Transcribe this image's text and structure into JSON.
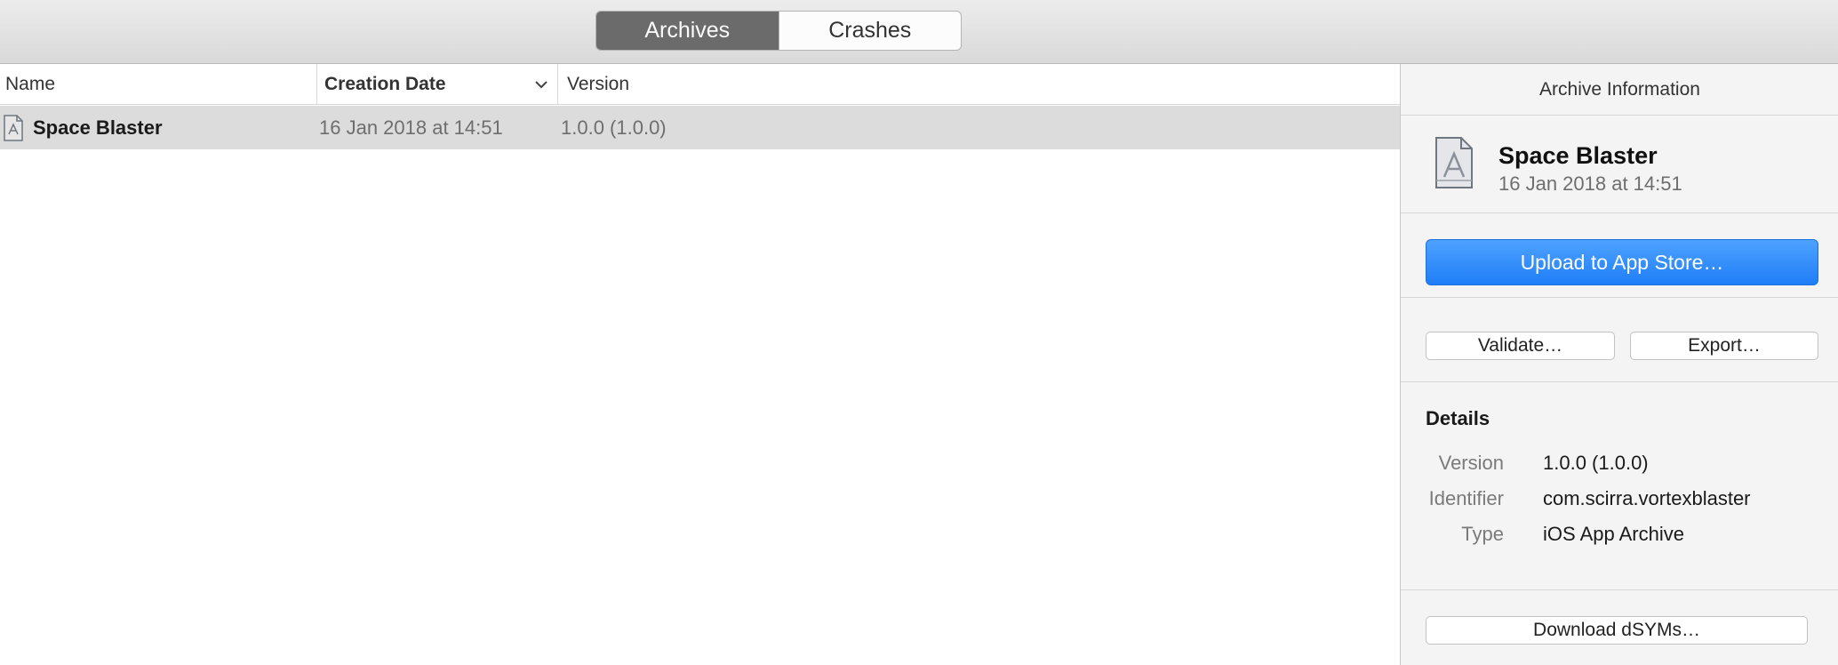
{
  "toolbar": {
    "tabs": [
      {
        "label": "Archives",
        "active": true
      },
      {
        "label": "Crashes",
        "active": false
      }
    ]
  },
  "table": {
    "columns": [
      "Name",
      "Creation Date",
      "Version"
    ],
    "sort_column": "Creation Date",
    "rows": [
      {
        "name": "Space Blaster",
        "date": "16 Jan 2018 at 14:51",
        "version": "1.0.0 (1.0.0)",
        "selected": true
      }
    ]
  },
  "sidebar": {
    "title": "Archive Information",
    "archive_name": "Space Blaster",
    "archive_date": "16 Jan 2018 at 14:51",
    "upload_label": "Upload to App Store…",
    "validate_label": "Validate…",
    "export_label": "Export…",
    "details_heading": "Details",
    "details": [
      {
        "key": "Version",
        "value": "1.0.0 (1.0.0)"
      },
      {
        "key": "Identifier",
        "value": "com.scirra.vortexblaster"
      },
      {
        "key": "Type",
        "value": "iOS App Archive"
      }
    ],
    "download_label": "Download dSYMs…"
  },
  "colors": {
    "accent": "#1f7ef7",
    "selected_row": "#dcdcdc",
    "active_tab": "#6b6b6b"
  },
  "icons": {
    "row_icon": "app-archive-icon",
    "sort": "chevron-down-icon",
    "summary_icon": "app-archive-icon"
  }
}
